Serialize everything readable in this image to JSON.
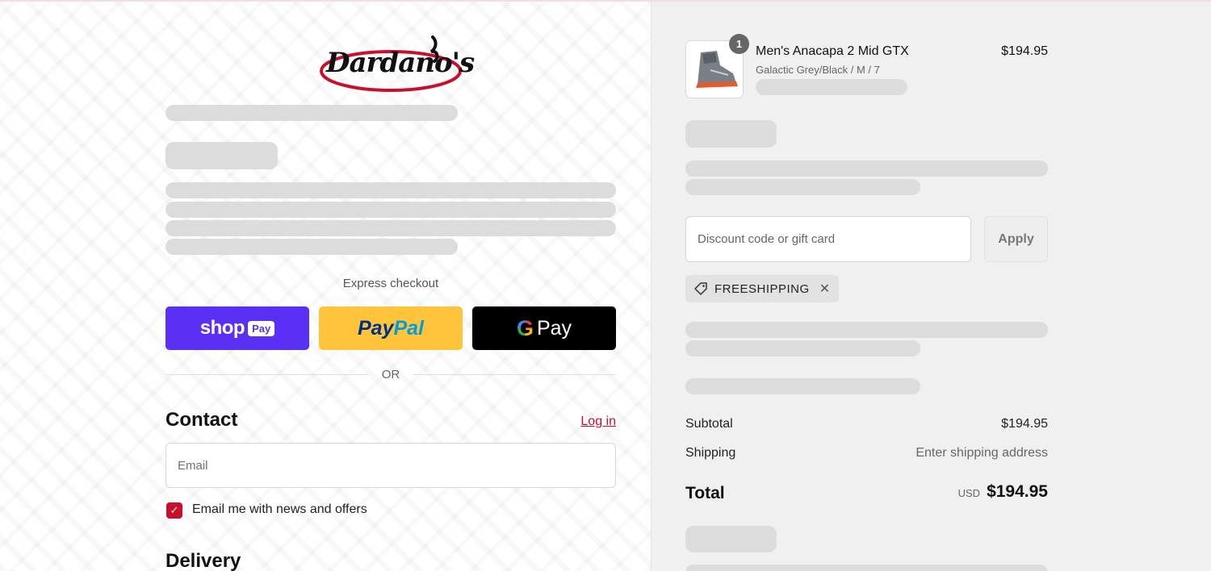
{
  "store": {
    "logo_text": "Dardano's"
  },
  "express": {
    "label": "Express checkout",
    "shop_pay": {
      "word": "shop",
      "pill": "Pay"
    },
    "paypal": {
      "part_a": "Pay",
      "part_b": "Pal"
    },
    "google_pay": {
      "g": "G",
      "word": "Pay"
    }
  },
  "divider": {
    "or_text": "OR"
  },
  "contact": {
    "title": "Contact",
    "login_link": "Log in",
    "email_placeholder": "Email",
    "newsletter_label": "Email me with news and offers",
    "newsletter_checked": true
  },
  "delivery": {
    "title": "Delivery"
  },
  "cart": {
    "item": {
      "name": "Men's Anacapa 2 Mid GTX",
      "variant": "Galactic Grey/Black / M / 7",
      "price": "$194.95",
      "quantity": "1"
    },
    "discount_placeholder": "Discount code or gift card",
    "apply_label": "Apply",
    "applied_code": "FREESHIPPING"
  },
  "summary": {
    "subtotal_label": "Subtotal",
    "subtotal_value": "$194.95",
    "shipping_label": "Shipping",
    "shipping_value": "Enter shipping address",
    "total_label": "Total",
    "currency": "USD",
    "total_value": "$194.95"
  },
  "colors": {
    "accent": "#c8102e",
    "shop_pay": "#5a31f4",
    "paypal": "#ffc439",
    "google_pay": "#000000",
    "summary_bg": "#f0f0f0",
    "skeleton": "#dcdcdc"
  },
  "icons": {
    "tag": "tag-icon",
    "close": "close-icon",
    "check": "checkmark-icon"
  }
}
